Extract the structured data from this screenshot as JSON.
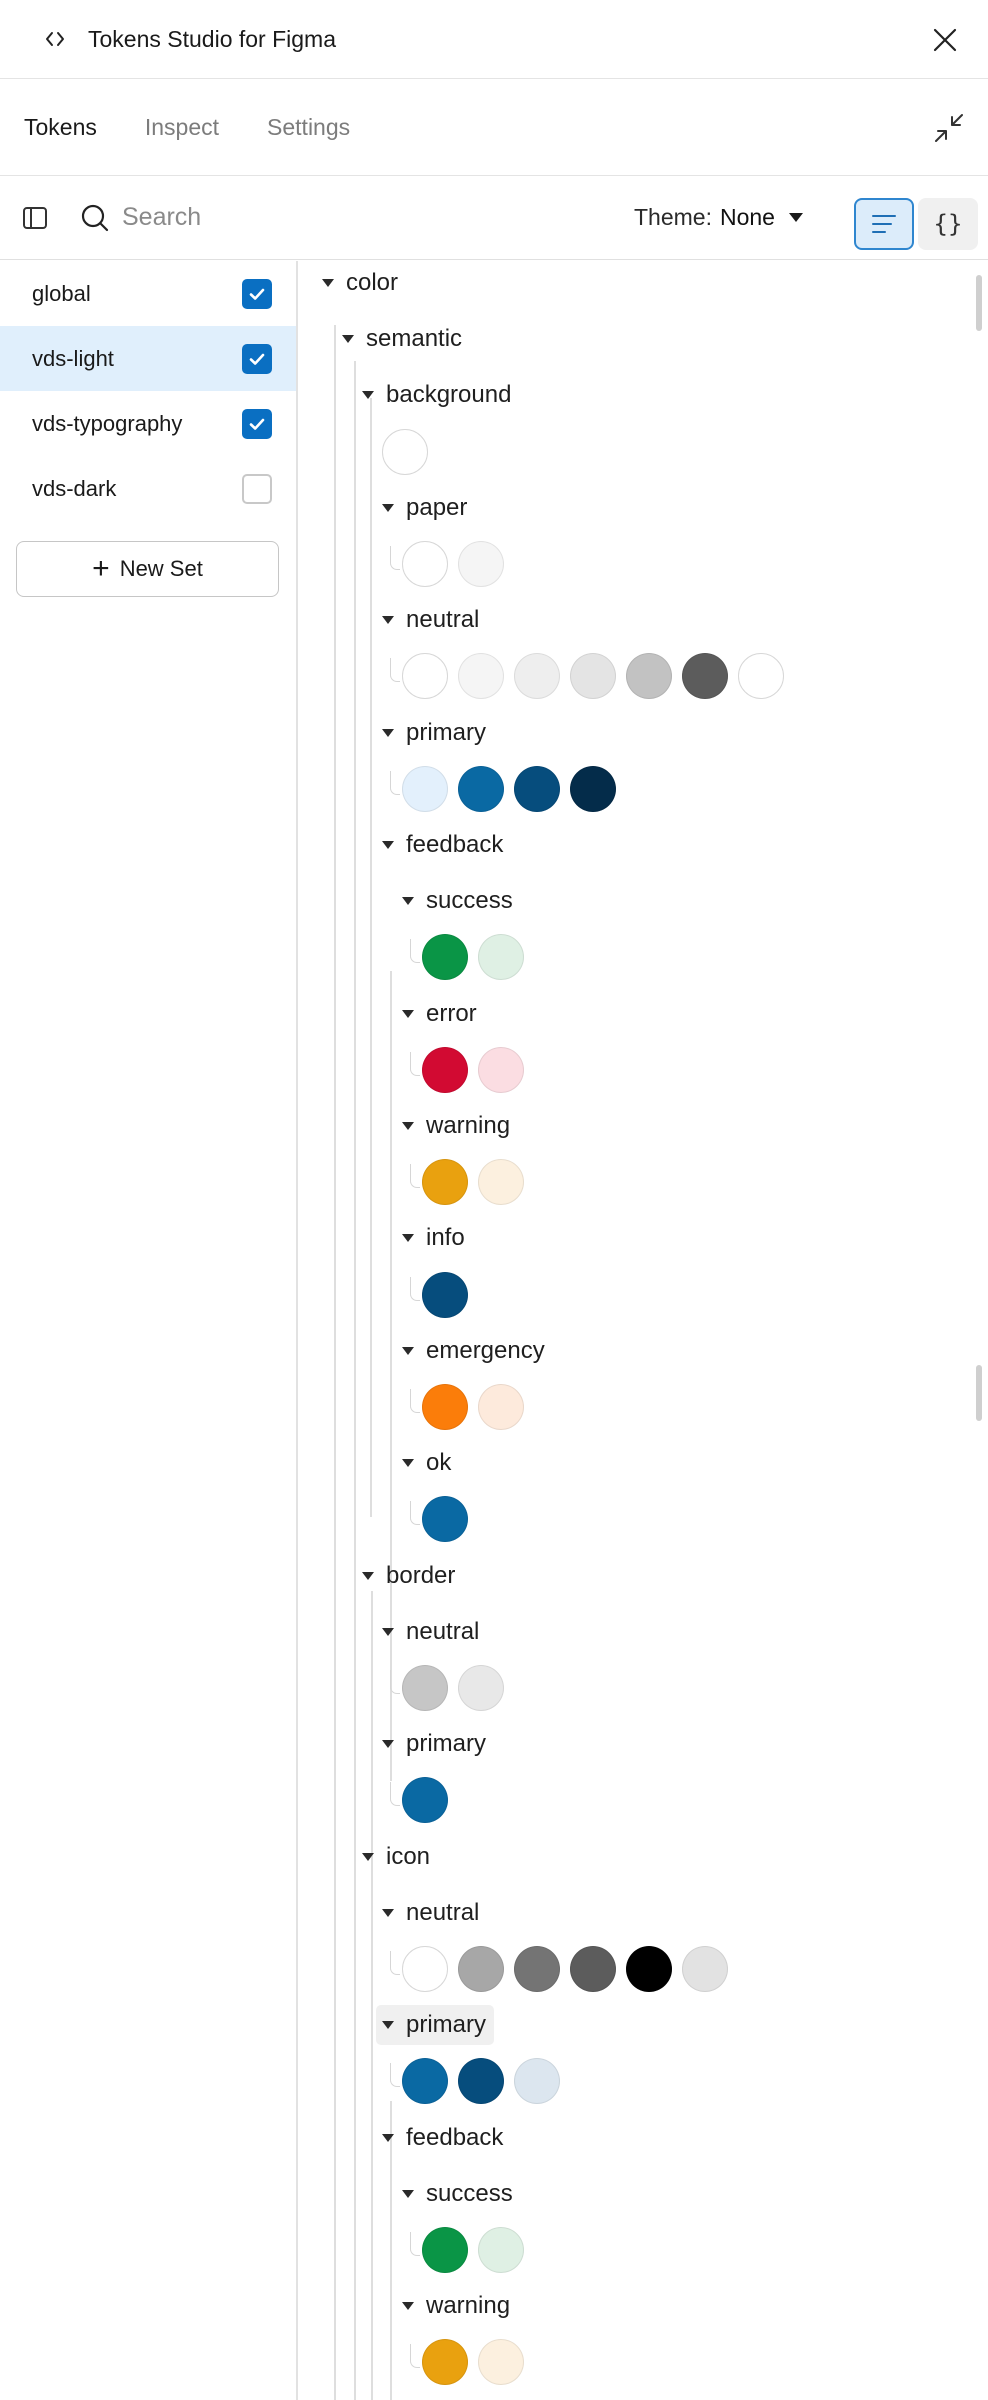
{
  "app": {
    "title": "Tokens Studio for Figma"
  },
  "tabs": [
    {
      "label": "Tokens",
      "active": true
    },
    {
      "label": "Inspect",
      "active": false
    },
    {
      "label": "Settings",
      "active": false
    }
  ],
  "toolbar": {
    "search_placeholder": "Search",
    "theme_label": "Theme:",
    "theme_value": "None"
  },
  "token_sets": [
    {
      "name": "global",
      "checked": true,
      "active": false
    },
    {
      "name": "vds-light",
      "checked": true,
      "active": true
    },
    {
      "name": "vds-typography",
      "checked": true,
      "active": false
    },
    {
      "name": "vds-dark",
      "checked": false,
      "active": false
    }
  ],
  "new_set_label": "New Set",
  "tree": [
    {
      "label": "color",
      "depth": 0
    },
    {
      "label": "semantic",
      "depth": 1
    },
    {
      "label": "background",
      "depth": 2
    },
    {
      "swatches": [
        "#ffffff"
      ],
      "depth": 2,
      "hook": false
    },
    {
      "label": "paper",
      "depth": 3
    },
    {
      "swatches": [
        "#ffffff",
        "#f5f5f5"
      ],
      "depth": 3,
      "hook": true
    },
    {
      "label": "neutral",
      "depth": 3
    },
    {
      "swatches": [
        "#ffffff",
        "#f5f5f5",
        "#eeeeee",
        "#e4e4e4",
        "#c2c2c2",
        "#5c5c5c",
        "#ffffff"
      ],
      "depth": 3,
      "hook": true
    },
    {
      "label": "primary",
      "depth": 3
    },
    {
      "swatches": [
        "#e3f0fc",
        "#0a69a3",
        "#064d7d",
        "#042c4a"
      ],
      "depth": 3,
      "hook": true
    },
    {
      "label": "feedback",
      "depth": 3
    },
    {
      "label": "success",
      "depth": 4
    },
    {
      "swatches": [
        "#0a9546",
        "#dff0e4"
      ],
      "depth": 4,
      "hook": true
    },
    {
      "label": "error",
      "depth": 4
    },
    {
      "swatches": [
        "#d20a32",
        "#fbdde2"
      ],
      "depth": 4,
      "hook": true
    },
    {
      "label": "warning",
      "depth": 4
    },
    {
      "swatches": [
        "#e9a10f",
        "#fcf0df"
      ],
      "depth": 4,
      "hook": true
    },
    {
      "label": "info",
      "depth": 4
    },
    {
      "swatches": [
        "#064d7d"
      ],
      "depth": 4,
      "hook": true
    },
    {
      "label": "emergency",
      "depth": 4
    },
    {
      "swatches": [
        "#fb7d0a",
        "#fdeadc"
      ],
      "depth": 4,
      "hook": true
    },
    {
      "label": "ok",
      "depth": 4
    },
    {
      "swatches": [
        "#0a69a3"
      ],
      "depth": 4,
      "hook": true
    },
    {
      "label": "border",
      "depth": 2
    },
    {
      "label": "neutral",
      "depth": 3
    },
    {
      "swatches": [
        "#c6c6c6",
        "#e8e8e8"
      ],
      "depth": 3,
      "hook": true
    },
    {
      "label": "primary",
      "depth": 3
    },
    {
      "swatches": [
        "#0a69a3"
      ],
      "depth": 3,
      "hook": true
    },
    {
      "label": "icon",
      "depth": 2
    },
    {
      "label": "neutral",
      "depth": 3
    },
    {
      "swatches": [
        "#ffffff",
        "#a7a7a7",
        "#747474",
        "#5c5c5c",
        "#000000",
        "#e2e2e2"
      ],
      "depth": 3,
      "hook": true
    },
    {
      "label": "primary",
      "depth": 3,
      "hover": true
    },
    {
      "swatches": [
        "#0a69a3",
        "#064d7d",
        "#dce6ef"
      ],
      "depth": 3,
      "hook": true
    },
    {
      "label": "feedback",
      "depth": 3
    },
    {
      "label": "success",
      "depth": 4
    },
    {
      "swatches": [
        "#0a9546",
        "#dff0e4"
      ],
      "depth": 4,
      "hook": true
    },
    {
      "label": "warning",
      "depth": 4
    },
    {
      "swatches": [
        "#e9a10f",
        "#fcf0df"
      ],
      "depth": 4,
      "hook": true
    }
  ],
  "colors": {
    "accent": "#0a6fc2",
    "active_row": "#e0effc"
  }
}
